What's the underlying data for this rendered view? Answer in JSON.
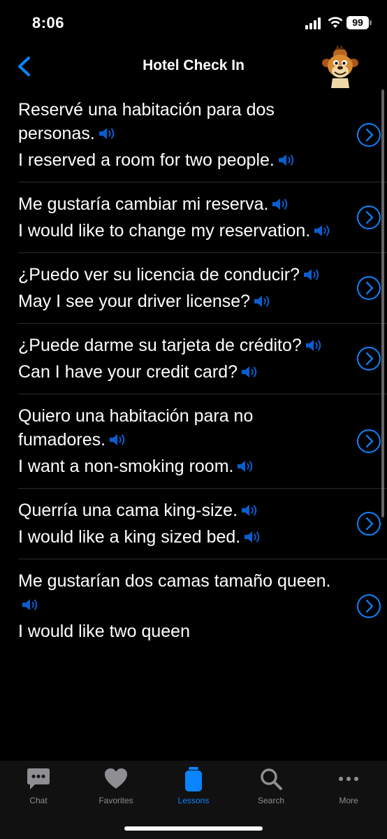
{
  "status_bar": {
    "time": "8:06",
    "battery": "99"
  },
  "nav": {
    "title": "Hotel Check In"
  },
  "phrases": [
    {
      "es": "Reservé una habitación para dos personas.",
      "en": "I reserved a room for two people."
    },
    {
      "es": "Me gustaría cambiar mi reserva.",
      "en": "I would like to change my reservation."
    },
    {
      "es": "¿Puedo ver su licencia de conducir?",
      "en": "May I see your driver license?"
    },
    {
      "es": "¿Puede darme su tarjeta de crédito?",
      "en": "Can I have your credit card?"
    },
    {
      "es": "Quiero una habitación para no fumadores.",
      "en": "I want a non-smoking room."
    },
    {
      "es": "Querría una cama king-size.",
      "en": "I would like a king sized bed."
    },
    {
      "es": "Me gustarían dos camas tamaño queen.",
      "en": "I would like two queen"
    }
  ],
  "tabs": [
    {
      "label": "Chat",
      "icon": "chat-bubble-icon"
    },
    {
      "label": "Favorites",
      "icon": "heart-icon"
    },
    {
      "label": "Lessons",
      "icon": "lessons-icon"
    },
    {
      "label": "Search",
      "icon": "search-icon"
    },
    {
      "label": "More",
      "icon": "more-icon"
    }
  ],
  "colors": {
    "accent": "#0a84ff",
    "speaker": "#0a5ecf",
    "background": "#000000",
    "tab_inactive": "#8e8e93"
  }
}
